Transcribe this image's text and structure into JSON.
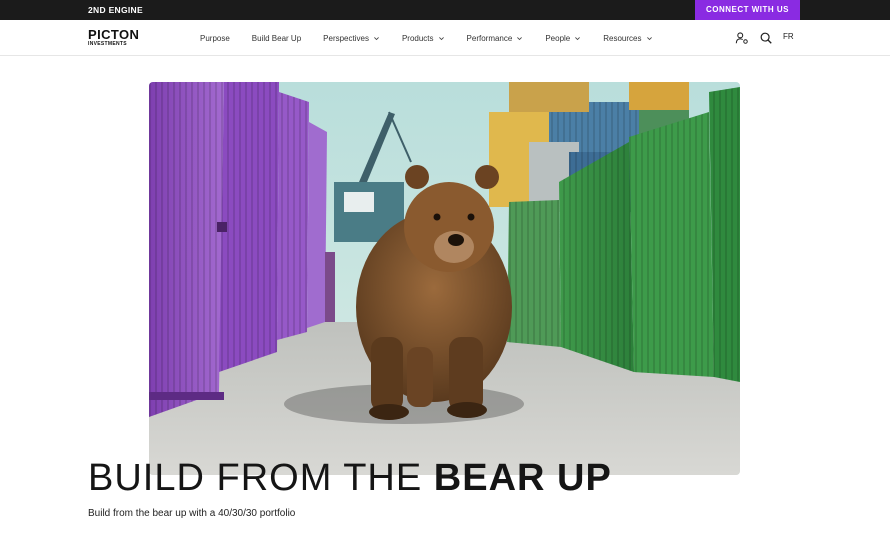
{
  "topbar": {
    "brand": "2ND ENGINE",
    "connect_label": "CONNECT WITH US"
  },
  "logo": {
    "name": "PICTON",
    "sub": "INVESTMENTS"
  },
  "nav": {
    "items": [
      {
        "label": "Purpose",
        "dropdown": false
      },
      {
        "label": "Build Bear Up",
        "dropdown": false
      },
      {
        "label": "Perspectives",
        "dropdown": true
      },
      {
        "label": "Products",
        "dropdown": true
      },
      {
        "label": "Performance",
        "dropdown": true
      },
      {
        "label": "People",
        "dropdown": true
      },
      {
        "label": "Resources",
        "dropdown": true
      }
    ],
    "lang": "FR",
    "icons": [
      "user-settings-icon",
      "search-icon"
    ]
  },
  "hero": {
    "headline_part1": "BUILD FROM THE ",
    "headline_part2": "BEAR UP",
    "subline": "Build from the bear up with a 40/30/30 portfolio"
  },
  "colors": {
    "accent": "#8a2be2",
    "topbar": "#1b1b1b"
  }
}
